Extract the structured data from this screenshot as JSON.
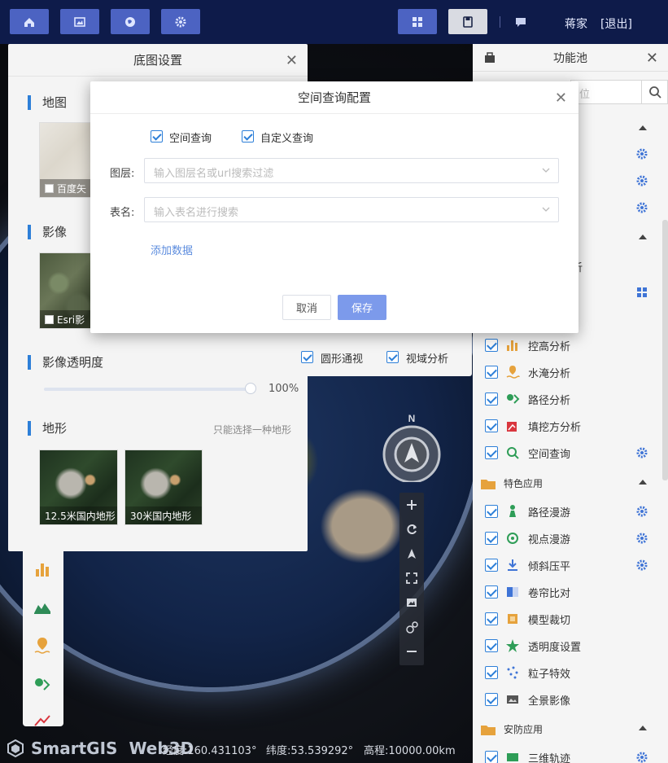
{
  "topbar": {
    "buttons": [
      "home-icon",
      "image-icon",
      "globe-icon",
      "gear-icon"
    ],
    "layout_icon": "grid-icon",
    "save_icon": "save-icon",
    "chat_icon": "chat-icon",
    "user_name": "蒋家",
    "logout": "[退出]"
  },
  "basemap_panel": {
    "title": "底图设置",
    "map_section": "地图",
    "map_thumb_label": "百度矢",
    "imagery_section": "影像",
    "imagery_thumb_label": "Esri影",
    "opacity_section": "影像透明度",
    "opacity_value": "100%",
    "opacity_level": 1.0,
    "terrain_section": "地形",
    "terrain_hint": "只能选择一种地形",
    "terrain_items": [
      "12.5米国内地形",
      "30米国内地形"
    ]
  },
  "function_pool": {
    "title": "功能池",
    "search_placeholder": "位",
    "partial_label": "析",
    "items_a": [
      {
        "label": "控高分析",
        "icon": "bar-chart-icon",
        "gear": false
      },
      {
        "label": "水淹分析",
        "icon": "flood-icon",
        "gear": false
      },
      {
        "label": "路径分析",
        "icon": "route-icon",
        "gear": false
      },
      {
        "label": "填挖方分析",
        "icon": "cut-fill-icon",
        "gear": false
      },
      {
        "label": "空间查询",
        "icon": "spatial-query-icon",
        "gear": true
      }
    ],
    "group_b": "特色应用",
    "items_b": [
      {
        "label": "路径漫游",
        "icon": "person-icon",
        "gear": true
      },
      {
        "label": "视点漫游",
        "icon": "eye-icon",
        "gear": true
      },
      {
        "label": "倾斜压平",
        "icon": "flatten-icon",
        "gear": true
      },
      {
        "label": "卷帘比对",
        "icon": "swipe-icon",
        "gear": false
      },
      {
        "label": "模型裁切",
        "icon": "clip-icon",
        "gear": false
      },
      {
        "label": "透明度设置",
        "icon": "transparency-icon",
        "gear": false
      },
      {
        "label": "粒子特效",
        "icon": "particle-icon",
        "gear": false
      },
      {
        "label": "全景影像",
        "icon": "panorama-icon",
        "gear": false
      }
    ],
    "group_c": "安防应用",
    "items_c": [
      {
        "label": "三维轨迹",
        "icon": "track-icon",
        "gear": true
      }
    ]
  },
  "analysis_popover": {
    "row1": [
      "",
      ""
    ],
    "row2": [
      "圆形通视",
      "视域分析"
    ]
  },
  "compass": {
    "label": "N"
  },
  "status": {
    "logo": "SmartGIS",
    "logo_suffix": "Web3D",
    "longitude": "经度:160.431103°",
    "latitude": "纬度:53.539292°",
    "elevation": "高程:10000.00km"
  },
  "modal": {
    "title": "空间查询配置",
    "check_spatial": "空间查询",
    "check_custom": "自定义查询",
    "layer_label": "图层:",
    "layer_placeholder": "输入图层名或url搜索过滤",
    "table_label": "表名:",
    "table_placeholder": "输入表名进行搜索",
    "add_data": "添加数据",
    "cancel": "取消",
    "save": "保存"
  },
  "colors": {
    "topbar_bg": "#0e1b4a",
    "topbar_button": "#4c63c2",
    "accent": "#2d7fd8",
    "save_button": "#7c9aeb",
    "link": "#5c8cde"
  }
}
